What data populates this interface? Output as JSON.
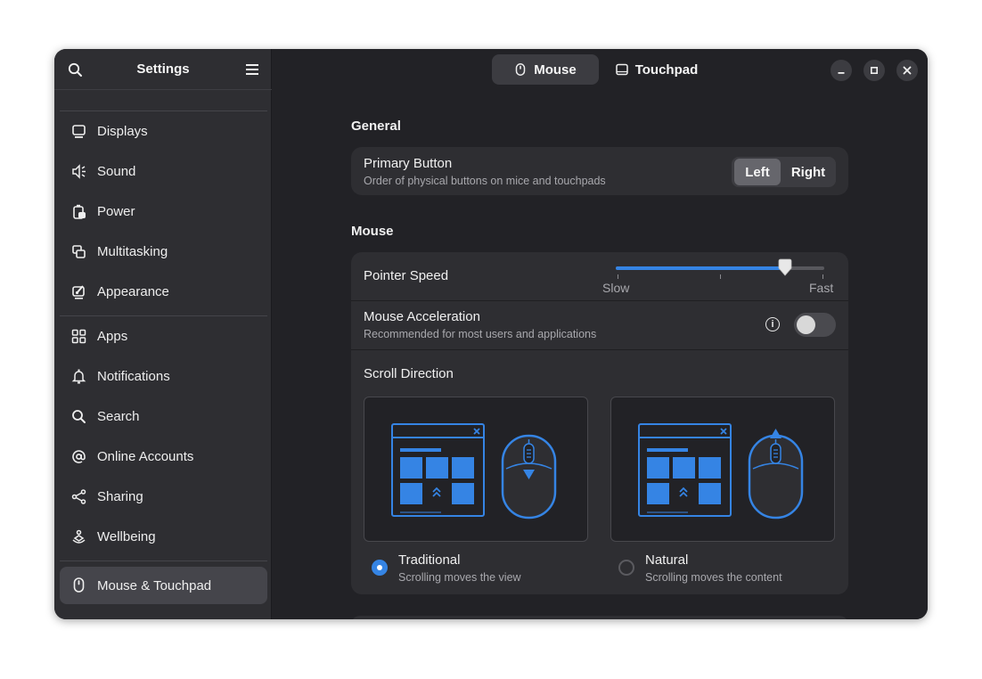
{
  "sidebar": {
    "title": "Settings",
    "items": [
      {
        "label": "Displays",
        "icon": "display-icon"
      },
      {
        "label": "Sound",
        "icon": "speaker-icon"
      },
      {
        "label": "Power",
        "icon": "battery-icon"
      },
      {
        "label": "Multitasking",
        "icon": "multitasking-icon"
      },
      {
        "label": "Appearance",
        "icon": "appearance-icon"
      },
      {
        "label": "Apps",
        "icon": "apps-grid-icon"
      },
      {
        "label": "Notifications",
        "icon": "bell-icon"
      },
      {
        "label": "Search",
        "icon": "search-icon"
      },
      {
        "label": "Online Accounts",
        "icon": "at-sign-icon"
      },
      {
        "label": "Sharing",
        "icon": "share-icon"
      },
      {
        "label": "Wellbeing",
        "icon": "wellbeing-icon"
      },
      {
        "label": "Mouse & Touchpad",
        "icon": "mouse-icon",
        "active": true
      }
    ]
  },
  "header": {
    "tabs": [
      {
        "label": "Mouse",
        "icon": "mouse-icon",
        "active": true
      },
      {
        "label": "Touchpad",
        "icon": "touchpad-icon",
        "active": false
      }
    ]
  },
  "general": {
    "title": "General",
    "primary_button": {
      "title": "Primary Button",
      "subtitle": "Order of physical buttons on mice and touchpads",
      "options": [
        "Left",
        "Right"
      ],
      "selected": "Left"
    }
  },
  "mouse": {
    "title": "Mouse",
    "pointer_speed": {
      "title": "Pointer Speed",
      "min_label": "Slow",
      "max_label": "Fast",
      "value": 0.81
    },
    "acceleration": {
      "title": "Mouse Acceleration",
      "subtitle": "Recommended for most users and applications",
      "enabled": false
    },
    "scroll_direction": {
      "title": "Scroll Direction",
      "options": [
        {
          "label": "Traditional",
          "subtitle": "Scrolling moves the view",
          "selected": true
        },
        {
          "label": "Natural",
          "subtitle": "Scrolling moves the content",
          "selected": false
        }
      ]
    }
  },
  "colors": {
    "accent": "#3584e4",
    "window_bg": "#222226",
    "sidebar_bg": "#2e2e32",
    "card_bg": "#2e2e32"
  }
}
